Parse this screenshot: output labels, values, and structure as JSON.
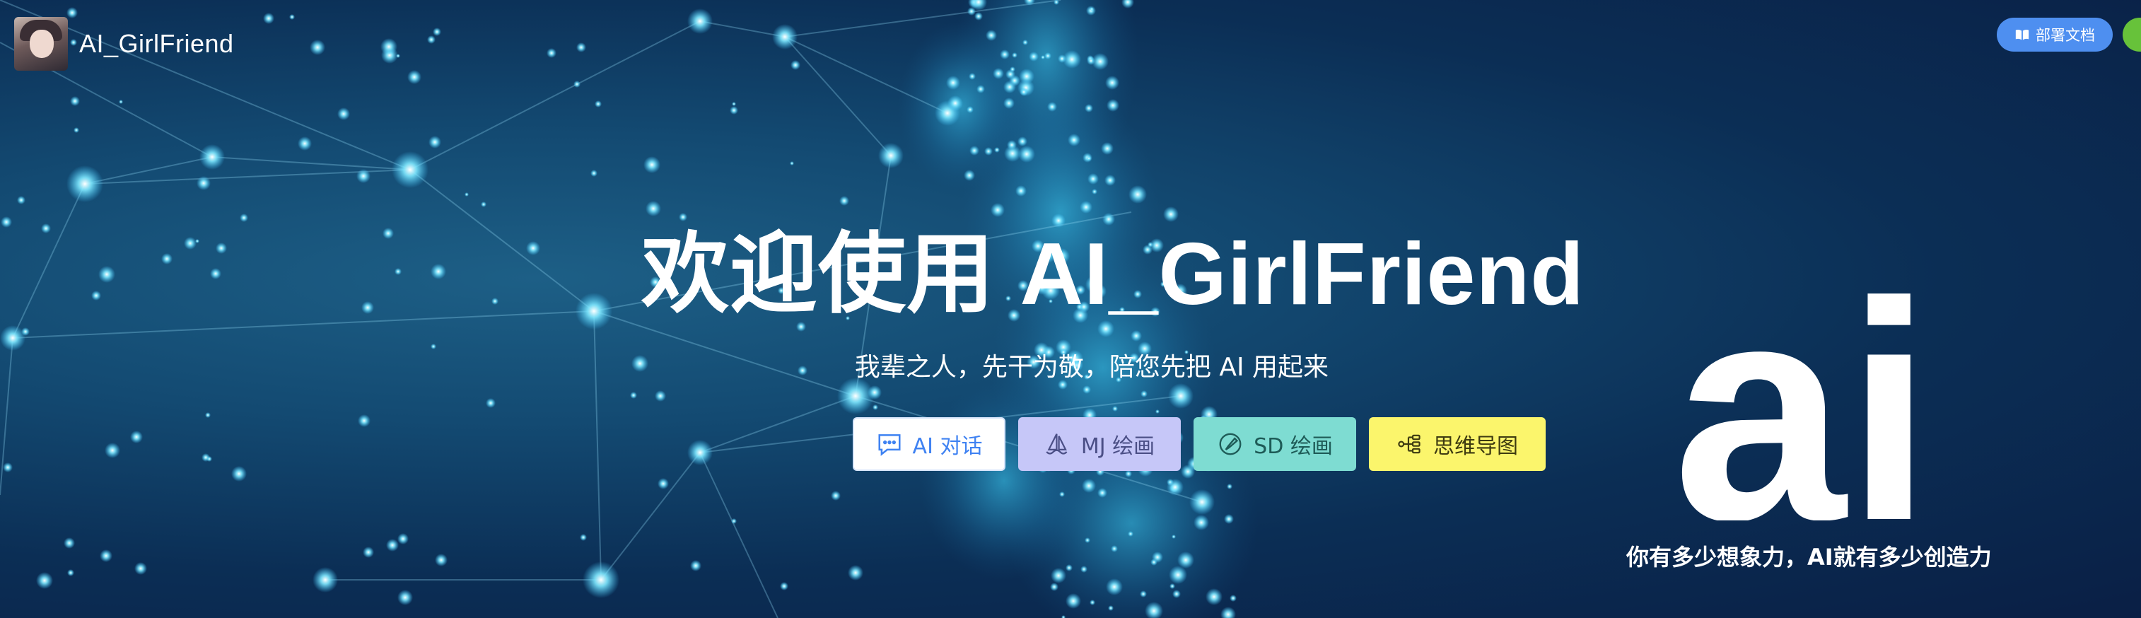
{
  "header": {
    "brand_name": "AI_GirlFriend",
    "doc_button_label": "部署文档",
    "doc_button_icon": "book-icon"
  },
  "hero": {
    "title": "欢迎使用 AI_GirlFriend",
    "subtitle": "我辈之人，先干为敬，陪您先把 AI 用起来"
  },
  "actions": [
    {
      "label": "AI 对话",
      "icon": "chat-icon",
      "color": "#3f82f2",
      "bg": "#ffffff"
    },
    {
      "label": "MJ 绘画",
      "icon": "sailboat-icon",
      "color": "#4b4f86",
      "bg": "#c6c7f8"
    },
    {
      "label": "SD 绘画",
      "icon": "brush-icon",
      "color": "#1e5b57",
      "bg": "#7edcd2"
    },
    {
      "label": "思维导图",
      "icon": "mindmap-icon",
      "color": "#3d3a10",
      "bg": "#fbf56c"
    }
  ],
  "decor": {
    "ai_logo_text": "ai",
    "slogan": "你有多少想象力，AI就有多少创造力"
  },
  "colors": {
    "background_dark": "#0a1f45",
    "background_light": "#1d5f86",
    "glow": "#5fe0ff",
    "doc_button": "#4e8ff0",
    "green_pill": "#67c23a"
  }
}
